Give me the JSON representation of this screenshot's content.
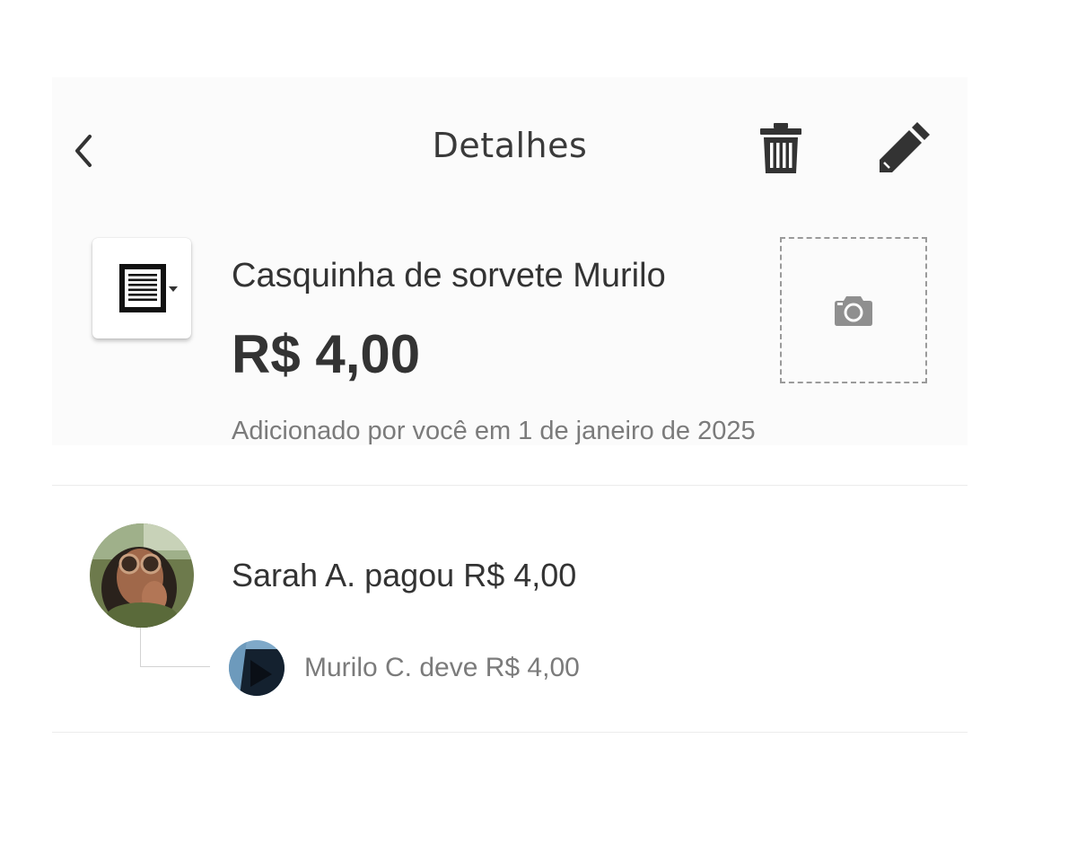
{
  "header": {
    "title": "Detalhes",
    "back_icon": "chevron-left-icon",
    "delete_icon": "trash-icon",
    "edit_icon": "pencil-icon"
  },
  "expense": {
    "category_icon": "receipt-document-icon",
    "name": "Casquinha de sorvete Murilo",
    "amount": "R$ 4,00",
    "photo_icon": "camera-icon",
    "added_by": "Adicionado por você em 1 de janeiro de 2025"
  },
  "payment": {
    "payer_text": "Sarah A. pagou R$ 4,00",
    "debtors": [
      {
        "text": "Murilo C. deve R$ 4,00"
      }
    ]
  },
  "colors": {
    "text": "#333333",
    "muted_text": "#7b7b7b",
    "icon": "#333333",
    "camera": "#8f8f8f"
  }
}
